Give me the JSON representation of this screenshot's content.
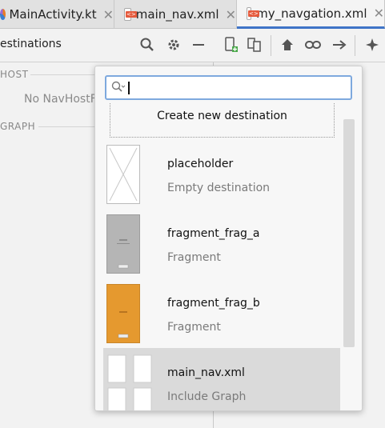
{
  "tabs": [
    {
      "label": "MainActivity.kt",
      "close": "✕",
      "icon": "kotlin-file-icon"
    },
    {
      "label": "main_nav.xml",
      "close": "✕",
      "icon": "xml-file-icon"
    },
    {
      "label": "my_navgation.xml",
      "close": "✕",
      "icon": "xml-file-icon",
      "active": true
    }
  ],
  "toolbar": {
    "title": "estinations",
    "icons": [
      "search-icon",
      "gear-icon",
      "minus-icon",
      "new-destination-icon",
      "nested-graph-icon",
      "home-icon",
      "link-icon",
      "arrow-right-icon",
      "magic-icon"
    ]
  },
  "left_panel": {
    "host_label": "HOST",
    "no_host_text": "No NavHostF",
    "graph_label": "GRAPH"
  },
  "popup": {
    "search": {
      "value": "",
      "placeholder": ""
    },
    "create_label": "Create new destination",
    "items": [
      {
        "name": "placeholder",
        "type": "Empty destination",
        "thumb": "empty"
      },
      {
        "name": "fragment_frag_a",
        "type": "Fragment",
        "thumb": "gray"
      },
      {
        "name": "fragment_frag_b",
        "type": "Fragment",
        "thumb": "orange"
      },
      {
        "name": "main_nav.xml",
        "type": "Include Graph",
        "thumb": "graph",
        "selected": true
      }
    ]
  },
  "colors": {
    "accent": "#3f74c7",
    "search_border": "#7ea9de",
    "frag_a": "#b5b5b5",
    "frag_b": "#e5992f"
  }
}
